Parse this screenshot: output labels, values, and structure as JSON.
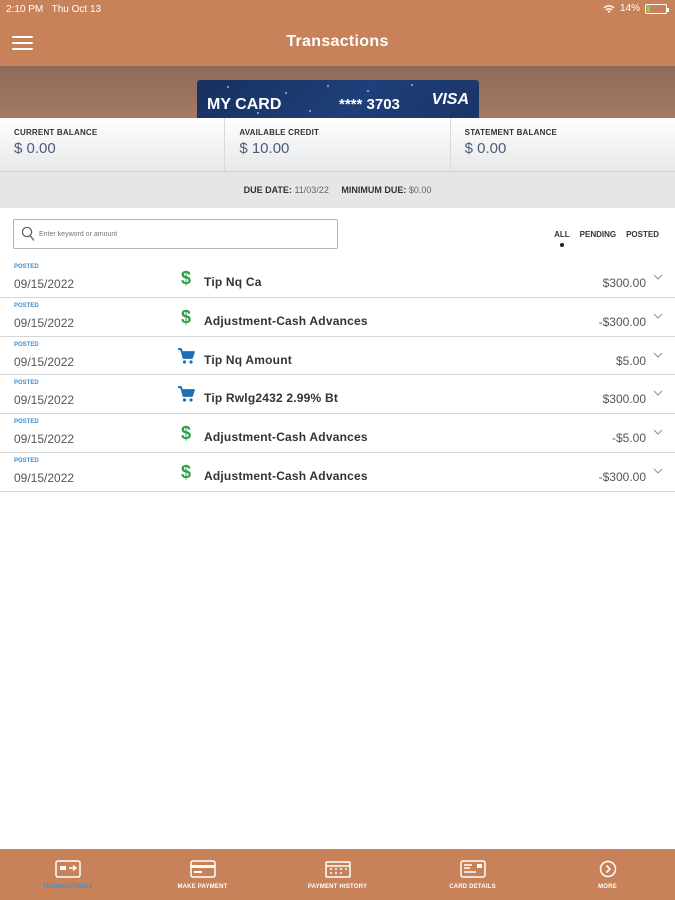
{
  "status_bar": {
    "time": "2:10 PM",
    "date": "Thu Oct 13",
    "battery": "14%",
    "battery_level": 0.14
  },
  "header": {
    "title": "Transactions",
    "menu_icon": "hamburger-menu-icon"
  },
  "card": {
    "name": "MY CARD",
    "number": "**** 3703",
    "brand": "VISA"
  },
  "balances": [
    {
      "label": "CURRENT BALANCE",
      "value": "$ 0.00"
    },
    {
      "label": "AVAILABLE CREDIT",
      "value": "$ 10.00"
    },
    {
      "label": "STATEMENT BALANCE",
      "value": "$ 0.00"
    }
  ],
  "due": {
    "due_date_label": "DUE DATE:",
    "due_date": "11/03/22",
    "minimum_due_label": "MINIMUM DUE:",
    "minimum_due": "$0.00"
  },
  "search": {
    "placeholder": "Enter keyword or amount"
  },
  "filters": {
    "all": "ALL",
    "pending": "PENDING",
    "posted": "POSTED",
    "selected": "ALL"
  },
  "transactions": [
    {
      "status": "POSTED",
      "date": "09/15/2022",
      "icon": "dollar-icon",
      "description": "Tip Nq Ca",
      "amount": "$300.00"
    },
    {
      "status": "POSTED",
      "date": "09/15/2022",
      "icon": "dollar-icon",
      "description": "Adjustment-Cash Advances",
      "amount": "-$300.00"
    },
    {
      "status": "POSTED",
      "date": "09/15/2022",
      "icon": "shopping-cart-icon",
      "description": "Tip Nq Amount",
      "amount": "$5.00"
    },
    {
      "status": "POSTED",
      "date": "09/15/2022",
      "icon": "shopping-cart-icon",
      "description": "Tip Rwlg2432 2.99% Bt",
      "amount": "$300.00"
    },
    {
      "status": "POSTED",
      "date": "09/15/2022",
      "icon": "dollar-icon",
      "description": "Adjustment-Cash Advances",
      "amount": "-$5.00"
    },
    {
      "status": "POSTED",
      "date": "09/15/2022",
      "icon": "dollar-icon",
      "description": "Adjustment-Cash Advances",
      "amount": "-$300.00"
    }
  ],
  "bottom_nav": [
    {
      "label": "TRANSACTIONS",
      "icon": "transactions-icon",
      "active": true
    },
    {
      "label": "MAKE PAYMENT",
      "icon": "make-payment-icon",
      "active": false
    },
    {
      "label": "PAYMENT HISTORY",
      "icon": "payment-history-icon",
      "active": false
    },
    {
      "label": "CARD DETAILS",
      "icon": "card-details-icon",
      "active": false
    },
    {
      "label": "MORE",
      "icon": "more-icon",
      "active": false
    }
  ],
  "colors": {
    "brand": "#c8825a",
    "accent": "#3b8fd6",
    "dollar_green": "#2e9e4a",
    "card_blue": "#1f3f7a",
    "cart_blue": "#1f6fb2"
  }
}
